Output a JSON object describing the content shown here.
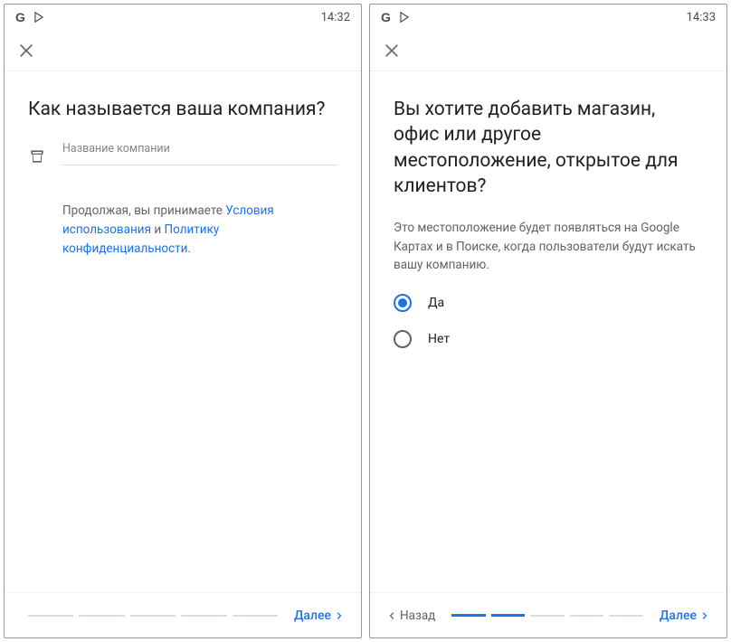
{
  "screen1": {
    "status_time": "14:32",
    "title": "Как называется ваша компания?",
    "input_label": "Название компании",
    "input_value": "",
    "terms_prefix": "Продолжая, вы принимаете ",
    "terms_link1": "Условия использования",
    "terms_mid": " и ",
    "terms_link2": "Политику конфиденциальности",
    "terms_suffix": ".",
    "next_label": "Далее"
  },
  "screen2": {
    "status_time": "14:33",
    "title": "Вы хотите добавить магазин, офис или другое местоположение, открытое для клиентов?",
    "subtitle": "Это местоположение будет появляться на Google Картах и в Поиске, когда пользователи будут искать вашу компанию.",
    "option_yes": "Да",
    "option_no": "Нет",
    "back_label": "Назад",
    "next_label": "Далее"
  }
}
